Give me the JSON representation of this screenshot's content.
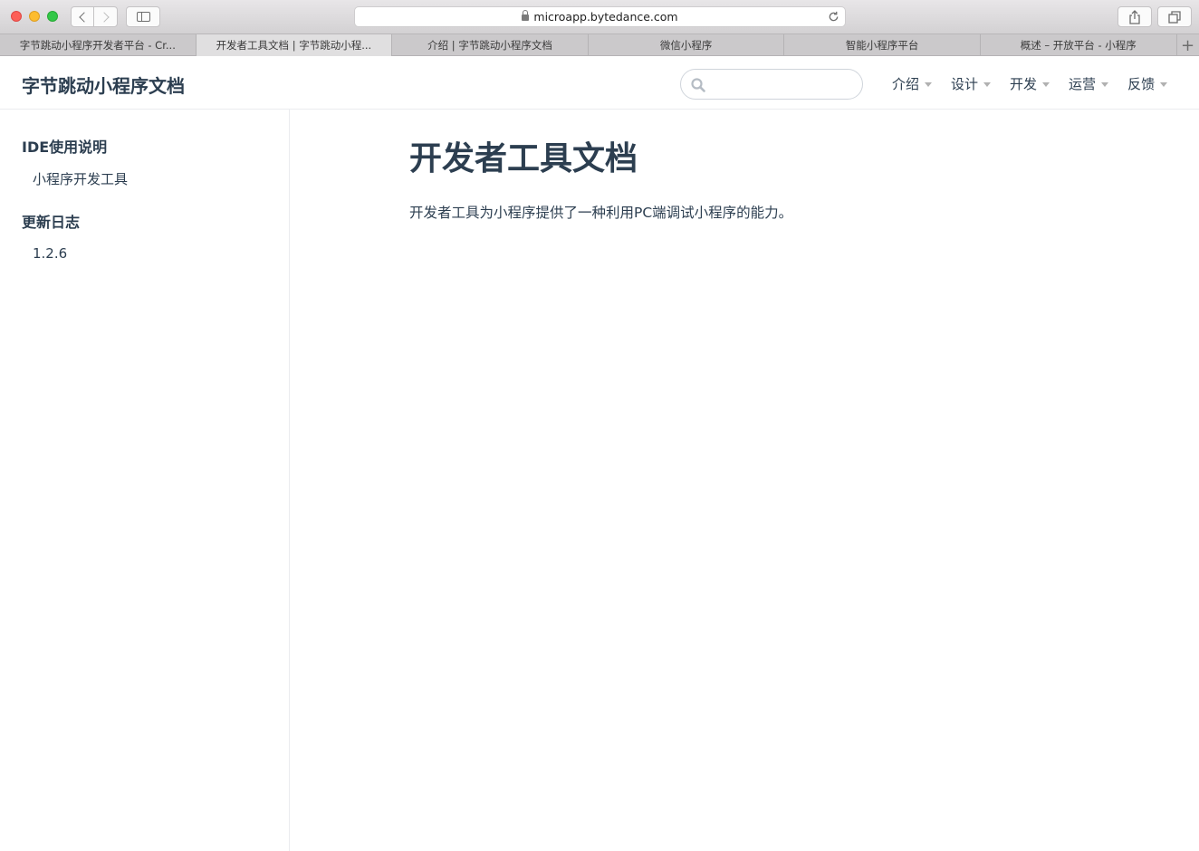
{
  "browser": {
    "url": "microapp.bytedance.com",
    "tabs": [
      {
        "label": "字节跳动小程序开发者平台 - Cr..."
      },
      {
        "label": "开发者工具文档 | 字节跳动小程..."
      },
      {
        "label": "介绍 | 字节跳动小程序文档"
      },
      {
        "label": "微信小程序"
      },
      {
        "label": "智能小程序平台"
      },
      {
        "label": "概述 – 开放平台 - 小程序"
      }
    ],
    "active_tab_index": 1,
    "new_tab_label": "+"
  },
  "header": {
    "site_title": "字节跳动小程序文档",
    "search_placeholder": "",
    "nav": [
      {
        "label": "介绍"
      },
      {
        "label": "设计"
      },
      {
        "label": "开发"
      },
      {
        "label": "运营"
      },
      {
        "label": "反馈"
      }
    ]
  },
  "sidebar": {
    "groups": [
      {
        "title": "IDE使用说明",
        "items": [
          {
            "label": "小程序开发工具"
          }
        ]
      },
      {
        "title": "更新日志",
        "items": [
          {
            "label": "1.2.6"
          }
        ]
      }
    ]
  },
  "main": {
    "title": "开发者工具文档",
    "paragraph": "开发者工具为小程序提供了一种利用PC端调试小程序的能力。"
  }
}
